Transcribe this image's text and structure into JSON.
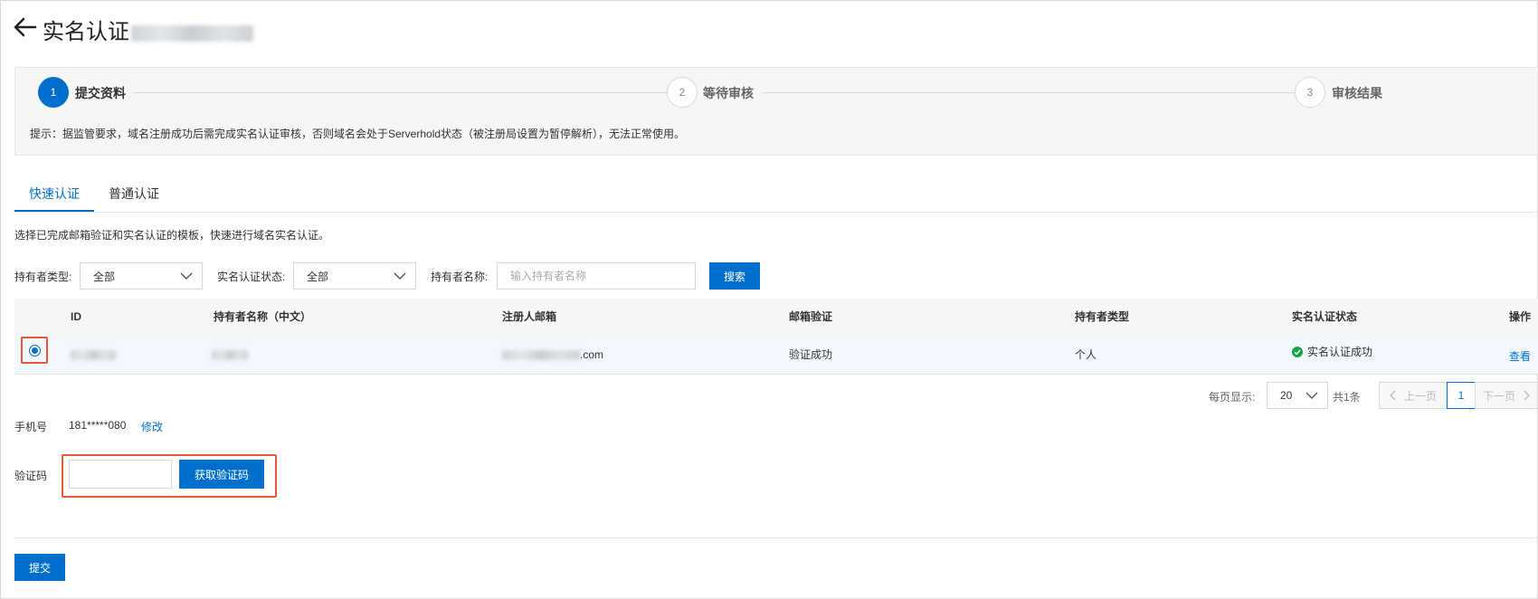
{
  "header": {
    "back_icon": "arrow-left-icon",
    "title": "实名认证",
    "title_suffix_redacted": true
  },
  "steps": [
    {
      "number": "1",
      "label": "提交资料",
      "state": "active"
    },
    {
      "number": "2",
      "label": "等待审核",
      "state": "pending"
    },
    {
      "number": "3",
      "label": "审核结果",
      "state": "pending"
    }
  ],
  "tip": "提示：据监管要求，域名注册成功后需完成实名认证审核，否则域名会处于Serverhold状态（被注册局设置为暂停解析），无法正常使用。",
  "tabs": [
    {
      "label": "快速认证",
      "active": true
    },
    {
      "label": "普通认证",
      "active": false
    }
  ],
  "description": "选择已完成邮箱验证和实名认证的模板，快速进行域名实名认证。",
  "filters": {
    "holder_type_label": "持有者类型:",
    "holder_type_value": "全部",
    "auth_status_label": "实名认证状态:",
    "auth_status_value": "全部",
    "holder_name_label": "持有者名称:",
    "holder_name_placeholder": "输入持有者名称",
    "search_button": "搜索"
  },
  "table": {
    "columns": [
      "ID",
      "持有者名称（中文）",
      "注册人邮箱",
      "邮箱验证",
      "持有者类型",
      "实名认证状态",
      "操作"
    ],
    "rows": [
      {
        "selected": true,
        "id": "",
        "holder_name": "",
        "email_suffix": ".com",
        "email_verify": "验证成功",
        "holder_type": "个人",
        "auth_status": "实名认证成功",
        "action": "查看"
      }
    ]
  },
  "pagination": {
    "per_page_label": "每页显示:",
    "per_page_value": "20",
    "total": "共1条",
    "prev": "上一页",
    "current_page": "1",
    "next": "下一页"
  },
  "phone": {
    "label": "手机号",
    "value": "181*****080",
    "edit_link": "修改"
  },
  "verify_code": {
    "label": "验证码",
    "input_value": "",
    "get_code_button": "获取验证码"
  },
  "submit_button": "提交",
  "colors": {
    "primary": "#0070cc",
    "highlight": "#e8573a",
    "success": "#1aa34a"
  }
}
